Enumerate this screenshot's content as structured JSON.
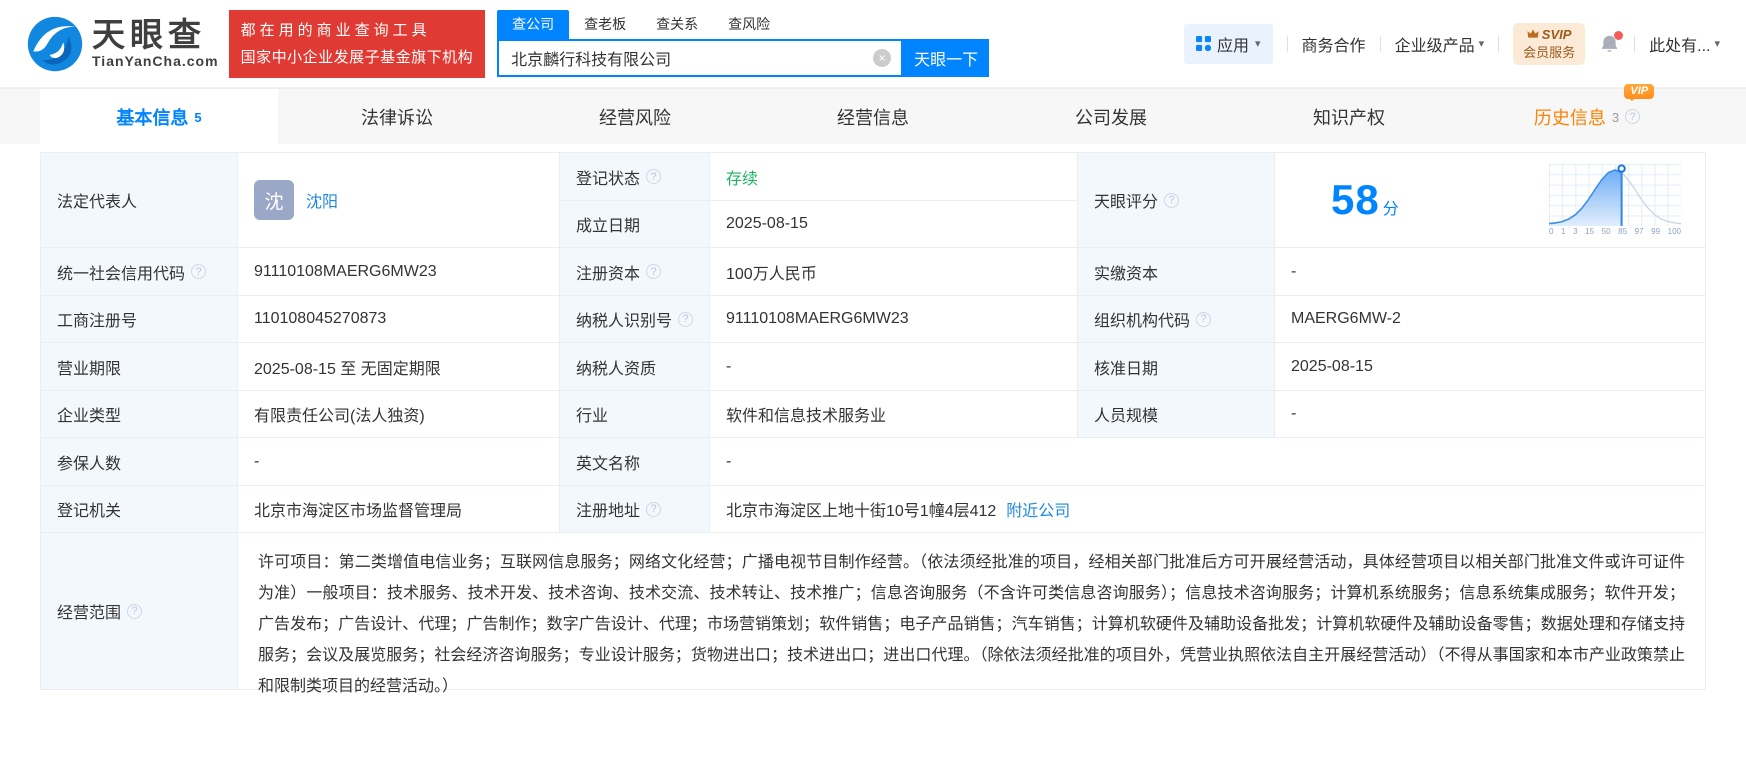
{
  "colors": {
    "accent": "#0084ff",
    "status_green": "#22b361",
    "history_orange": "#ff8200",
    "banner_red": "#e03a34"
  },
  "icons": {
    "clear": "×",
    "caret": "▾",
    "help": "?"
  },
  "header": {
    "logo_brand": "天眼查",
    "logo_domain": "TianYanCha.com",
    "slogan1": "都在用的商业查询工具",
    "slogan2": "国家中小企业发展子基金旗下机构",
    "search_tabs": [
      "查公司",
      "查老板",
      "查关系",
      "查风险"
    ],
    "search_value": "北京麟行科技有限公司",
    "search_button": "天眼一下",
    "nav_apps": "应用",
    "nav_biz": "商务合作",
    "nav_enterprise": "企业级产品",
    "svip_top": "SVIP",
    "svip_bottom": "会员服务",
    "nav_more": "此处有..."
  },
  "tabs": [
    {
      "label": "基本信息",
      "badge": "5"
    },
    {
      "label": "法律诉讼"
    },
    {
      "label": "经营风险"
    },
    {
      "label": "经营信息"
    },
    {
      "label": "公司发展"
    },
    {
      "label": "知识产权"
    },
    {
      "label": "历史信息",
      "badge": "3",
      "vip": "VIP"
    }
  ],
  "fields": {
    "legal_rep": {
      "label": "法定代表人",
      "avatar": "沈",
      "name": "沈阳"
    },
    "reg_status": {
      "label": "登记状态",
      "value": "存续"
    },
    "establish_date": {
      "label": "成立日期",
      "value": "2025-08-15"
    },
    "score": {
      "label": "天眼评分"
    },
    "uscc": {
      "label": "统一社会信用代码",
      "value": "91110108MAERG6MW23"
    },
    "reg_capital": {
      "label": "注册资本",
      "value": "100万人民币"
    },
    "paid_capital": {
      "label": "实缴资本",
      "value": "-"
    },
    "reg_no": {
      "label": "工商注册号",
      "value": "110108045270873"
    },
    "taxpayer_id": {
      "label": "纳税人识别号",
      "value": "91110108MAERG6MW23"
    },
    "org_code": {
      "label": "组织机构代码",
      "value": "MAERG6MW-2"
    },
    "business_term": {
      "label": "营业期限",
      "value": "2025-08-15 至 无固定期限"
    },
    "taxpayer_quality": {
      "label": "纳税人资质",
      "value": "-"
    },
    "approval_date": {
      "label": "核准日期",
      "value": "2025-08-15"
    },
    "company_type": {
      "label": "企业类型",
      "value": "有限责任公司(法人独资)"
    },
    "industry": {
      "label": "行业",
      "value": "软件和信息技术服务业"
    },
    "staff_size": {
      "label": "人员规模",
      "value": "-"
    },
    "insured_count": {
      "label": "参保人数",
      "value": "-"
    },
    "english_name": {
      "label": "英文名称",
      "value": "-"
    },
    "reg_authority": {
      "label": "登记机关",
      "value": "北京市海淀区市场监督管理局"
    },
    "reg_address": {
      "label": "注册地址",
      "value": "北京市海淀区上地十街10号1幢4层412",
      "nearby_link": "附近公司"
    },
    "business_scope": {
      "label": "经营范围",
      "value": "许可项目：第二类增值电信业务；互联网信息服务；网络文化经营；广播电视节目制作经营。（依法须经批准的项目，经相关部门批准后方可开展经营活动，具体经营项目以相关部门批准文件或许可证件为准）一般项目：技术服务、技术开发、技术咨询、技术交流、技术转让、技术推广；信息咨询服务（不含许可类信息咨询服务）；信息技术咨询服务；计算机系统服务；信息系统集成服务；软件开发；广告发布；广告设计、代理；广告制作；数字广告设计、代理；市场营销策划；软件销售；电子产品销售；汽车销售；计算机软硬件及辅助设备批发；计算机软硬件及辅助设备零售；数据处理和存储支持服务；会议及展览服务；社会经济咨询服务；专业设计服务；货物进出口；技术进出口；进出口代理。（除依法须经批准的项目外，凭营业执照依法自主开展经营活动）（不得从事国家和本市产业政策禁止和限制类项目的经营活动。）"
    }
  },
  "chart_data": {
    "type": "area",
    "title": "天眼评分",
    "score": "58",
    "unit": "分",
    "x_tick_labels": [
      "0",
      "1",
      "3",
      "15",
      "50",
      "85",
      "97",
      "99",
      "100"
    ],
    "marker_fraction": 0.55,
    "points": [
      [
        0,
        0.008
      ],
      [
        0.05,
        0.02
      ],
      [
        0.1,
        0.044
      ],
      [
        0.15,
        0.092
      ],
      [
        0.2,
        0.172
      ],
      [
        0.25,
        0.295
      ],
      [
        0.3,
        0.458
      ],
      [
        0.35,
        0.644
      ],
      [
        0.4,
        0.823
      ],
      [
        0.45,
        0.952
      ],
      [
        0.5,
        1
      ],
      [
        0.55,
        0.952
      ],
      [
        0.6,
        0.823
      ],
      [
        0.65,
        0.644
      ],
      [
        0.7,
        0.458
      ],
      [
        0.75,
        0.295
      ],
      [
        0.8,
        0.172
      ],
      [
        0.85,
        0.092
      ],
      [
        0.9,
        0.044
      ],
      [
        0.95,
        0.02
      ],
      [
        1,
        0.008
      ]
    ],
    "grid": true,
    "legend": false
  }
}
